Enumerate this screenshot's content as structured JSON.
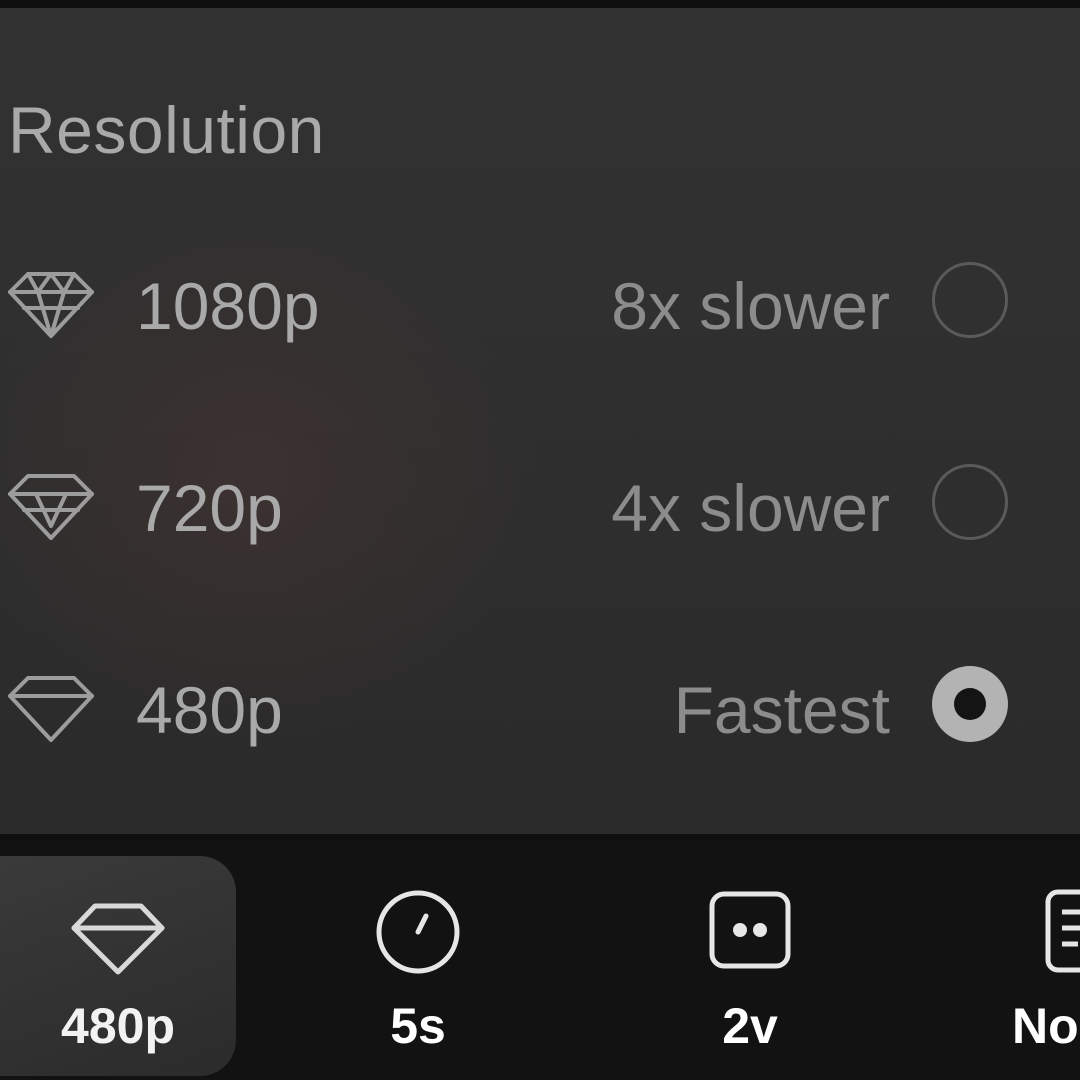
{
  "panel": {
    "title": "Resolution",
    "options": [
      {
        "label": "1080p",
        "speed": "8x slower",
        "icon": "diamond-large-icon",
        "selected": false
      },
      {
        "label": "720p",
        "speed": "4x slower",
        "icon": "diamond-medium-icon",
        "selected": false
      },
      {
        "label": "480p",
        "speed": "Fastest",
        "icon": "diamond-small-icon",
        "selected": true
      }
    ]
  },
  "toolbar": {
    "items": [
      {
        "label": "480p",
        "icon": "diamond-icon",
        "active": true
      },
      {
        "label": "5s",
        "icon": "timer-icon",
        "active": false
      },
      {
        "label": "2v",
        "icon": "variations-icon",
        "active": false
      },
      {
        "label": "No",
        "icon": "storyboard-icon",
        "active": false
      }
    ]
  },
  "colors": {
    "panel_background": "#2e2e2e",
    "toolbar_background": "#121212",
    "text_primary": "#a9a9a9",
    "text_secondary": "#8c8c8c",
    "radio_selected": "#b3b3b3",
    "label_white": "#ffffff"
  }
}
